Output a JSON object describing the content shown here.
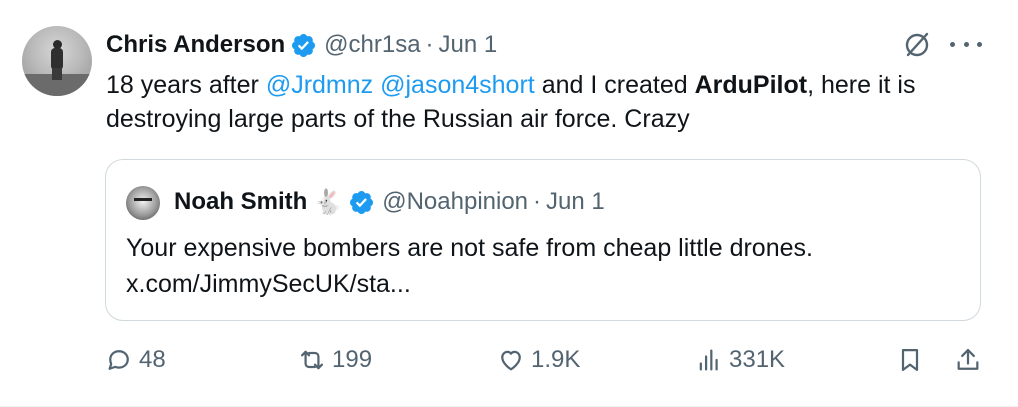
{
  "tweet": {
    "author_name": "Chris Anderson",
    "handle": "@chr1sa",
    "separator": "·",
    "date": "Jun 1",
    "text_parts": {
      "p1": "18 years after ",
      "mention1": "@Jrdmnz",
      "p2": " ",
      "mention2": "@jason4short",
      "p3": " and I created ",
      "bold": "ArduPilot",
      "p4": ", here it is destroying large parts of the Russian air force. Crazy"
    }
  },
  "quoted_tweet": {
    "author_name": "Noah Smith",
    "emoji": "🐇",
    "handle": "@Noahpinion",
    "separator": "·",
    "date": "Jun 1",
    "text_line1": "Your expensive bombers are not safe from cheap little drones.",
    "text_line2": "x.com/JimmySecUK/sta..."
  },
  "actions": {
    "replies": "48",
    "reposts": "199",
    "likes": "1.9K",
    "views": "331K"
  },
  "colors": {
    "accent": "#1d9bf0",
    "muted": "#536471",
    "text": "#0f1419",
    "border": "#cfd9de"
  },
  "icons": [
    "verified-badge-icon",
    "grok-icon",
    "more-icon",
    "reply-icon",
    "repost-icon",
    "like-icon",
    "views-icon",
    "bookmark-icon",
    "share-icon"
  ]
}
